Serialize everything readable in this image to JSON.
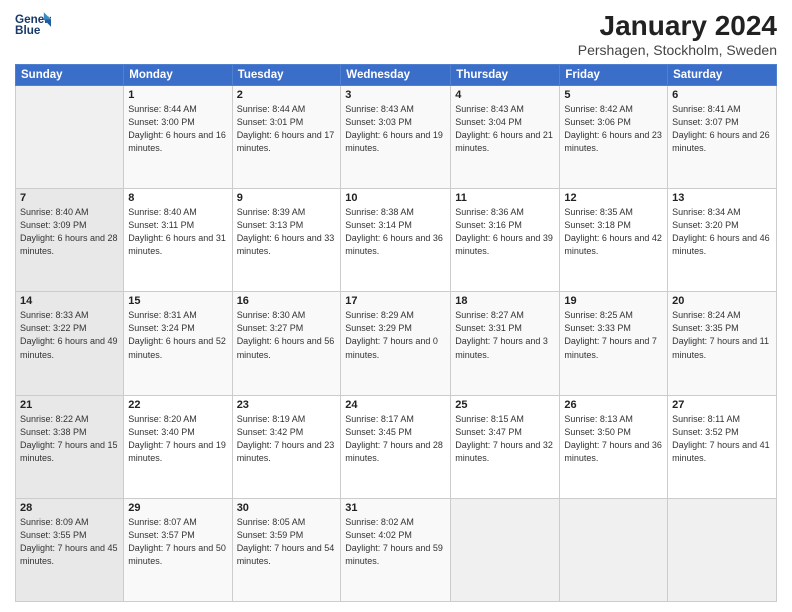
{
  "header": {
    "logo_line1": "General",
    "logo_line2": "Blue",
    "month": "January 2024",
    "location": "Pershagen, Stockholm, Sweden"
  },
  "weekdays": [
    "Sunday",
    "Monday",
    "Tuesday",
    "Wednesday",
    "Thursday",
    "Friday",
    "Saturday"
  ],
  "weeks": [
    [
      {
        "num": "",
        "sunrise": "",
        "sunset": "",
        "daylight": ""
      },
      {
        "num": "1",
        "sunrise": "Sunrise: 8:44 AM",
        "sunset": "Sunset: 3:00 PM",
        "daylight": "Daylight: 6 hours and 16 minutes."
      },
      {
        "num": "2",
        "sunrise": "Sunrise: 8:44 AM",
        "sunset": "Sunset: 3:01 PM",
        "daylight": "Daylight: 6 hours and 17 minutes."
      },
      {
        "num": "3",
        "sunrise": "Sunrise: 8:43 AM",
        "sunset": "Sunset: 3:03 PM",
        "daylight": "Daylight: 6 hours and 19 minutes."
      },
      {
        "num": "4",
        "sunrise": "Sunrise: 8:43 AM",
        "sunset": "Sunset: 3:04 PM",
        "daylight": "Daylight: 6 hours and 21 minutes."
      },
      {
        "num": "5",
        "sunrise": "Sunrise: 8:42 AM",
        "sunset": "Sunset: 3:06 PM",
        "daylight": "Daylight: 6 hours and 23 minutes."
      },
      {
        "num": "6",
        "sunrise": "Sunrise: 8:41 AM",
        "sunset": "Sunset: 3:07 PM",
        "daylight": "Daylight: 6 hours and 26 minutes."
      }
    ],
    [
      {
        "num": "7",
        "sunrise": "Sunrise: 8:40 AM",
        "sunset": "Sunset: 3:09 PM",
        "daylight": "Daylight: 6 hours and 28 minutes."
      },
      {
        "num": "8",
        "sunrise": "Sunrise: 8:40 AM",
        "sunset": "Sunset: 3:11 PM",
        "daylight": "Daylight: 6 hours and 31 minutes."
      },
      {
        "num": "9",
        "sunrise": "Sunrise: 8:39 AM",
        "sunset": "Sunset: 3:13 PM",
        "daylight": "Daylight: 6 hours and 33 minutes."
      },
      {
        "num": "10",
        "sunrise": "Sunrise: 8:38 AM",
        "sunset": "Sunset: 3:14 PM",
        "daylight": "Daylight: 6 hours and 36 minutes."
      },
      {
        "num": "11",
        "sunrise": "Sunrise: 8:36 AM",
        "sunset": "Sunset: 3:16 PM",
        "daylight": "Daylight: 6 hours and 39 minutes."
      },
      {
        "num": "12",
        "sunrise": "Sunrise: 8:35 AM",
        "sunset": "Sunset: 3:18 PM",
        "daylight": "Daylight: 6 hours and 42 minutes."
      },
      {
        "num": "13",
        "sunrise": "Sunrise: 8:34 AM",
        "sunset": "Sunset: 3:20 PM",
        "daylight": "Daylight: 6 hours and 46 minutes."
      }
    ],
    [
      {
        "num": "14",
        "sunrise": "Sunrise: 8:33 AM",
        "sunset": "Sunset: 3:22 PM",
        "daylight": "Daylight: 6 hours and 49 minutes."
      },
      {
        "num": "15",
        "sunrise": "Sunrise: 8:31 AM",
        "sunset": "Sunset: 3:24 PM",
        "daylight": "Daylight: 6 hours and 52 minutes."
      },
      {
        "num": "16",
        "sunrise": "Sunrise: 8:30 AM",
        "sunset": "Sunset: 3:27 PM",
        "daylight": "Daylight: 6 hours and 56 minutes."
      },
      {
        "num": "17",
        "sunrise": "Sunrise: 8:29 AM",
        "sunset": "Sunset: 3:29 PM",
        "daylight": "Daylight: 7 hours and 0 minutes."
      },
      {
        "num": "18",
        "sunrise": "Sunrise: 8:27 AM",
        "sunset": "Sunset: 3:31 PM",
        "daylight": "Daylight: 7 hours and 3 minutes."
      },
      {
        "num": "19",
        "sunrise": "Sunrise: 8:25 AM",
        "sunset": "Sunset: 3:33 PM",
        "daylight": "Daylight: 7 hours and 7 minutes."
      },
      {
        "num": "20",
        "sunrise": "Sunrise: 8:24 AM",
        "sunset": "Sunset: 3:35 PM",
        "daylight": "Daylight: 7 hours and 11 minutes."
      }
    ],
    [
      {
        "num": "21",
        "sunrise": "Sunrise: 8:22 AM",
        "sunset": "Sunset: 3:38 PM",
        "daylight": "Daylight: 7 hours and 15 minutes."
      },
      {
        "num": "22",
        "sunrise": "Sunrise: 8:20 AM",
        "sunset": "Sunset: 3:40 PM",
        "daylight": "Daylight: 7 hours and 19 minutes."
      },
      {
        "num": "23",
        "sunrise": "Sunrise: 8:19 AM",
        "sunset": "Sunset: 3:42 PM",
        "daylight": "Daylight: 7 hours and 23 minutes."
      },
      {
        "num": "24",
        "sunrise": "Sunrise: 8:17 AM",
        "sunset": "Sunset: 3:45 PM",
        "daylight": "Daylight: 7 hours and 28 minutes."
      },
      {
        "num": "25",
        "sunrise": "Sunrise: 8:15 AM",
        "sunset": "Sunset: 3:47 PM",
        "daylight": "Daylight: 7 hours and 32 minutes."
      },
      {
        "num": "26",
        "sunrise": "Sunrise: 8:13 AM",
        "sunset": "Sunset: 3:50 PM",
        "daylight": "Daylight: 7 hours and 36 minutes."
      },
      {
        "num": "27",
        "sunrise": "Sunrise: 8:11 AM",
        "sunset": "Sunset: 3:52 PM",
        "daylight": "Daylight: 7 hours and 41 minutes."
      }
    ],
    [
      {
        "num": "28",
        "sunrise": "Sunrise: 8:09 AM",
        "sunset": "Sunset: 3:55 PM",
        "daylight": "Daylight: 7 hours and 45 minutes."
      },
      {
        "num": "29",
        "sunrise": "Sunrise: 8:07 AM",
        "sunset": "Sunset: 3:57 PM",
        "daylight": "Daylight: 7 hours and 50 minutes."
      },
      {
        "num": "30",
        "sunrise": "Sunrise: 8:05 AM",
        "sunset": "Sunset: 3:59 PM",
        "daylight": "Daylight: 7 hours and 54 minutes."
      },
      {
        "num": "31",
        "sunrise": "Sunrise: 8:02 AM",
        "sunset": "Sunset: 4:02 PM",
        "daylight": "Daylight: 7 hours and 59 minutes."
      },
      {
        "num": "",
        "sunrise": "",
        "sunset": "",
        "daylight": ""
      },
      {
        "num": "",
        "sunrise": "",
        "sunset": "",
        "daylight": ""
      },
      {
        "num": "",
        "sunrise": "",
        "sunset": "",
        "daylight": ""
      }
    ]
  ]
}
